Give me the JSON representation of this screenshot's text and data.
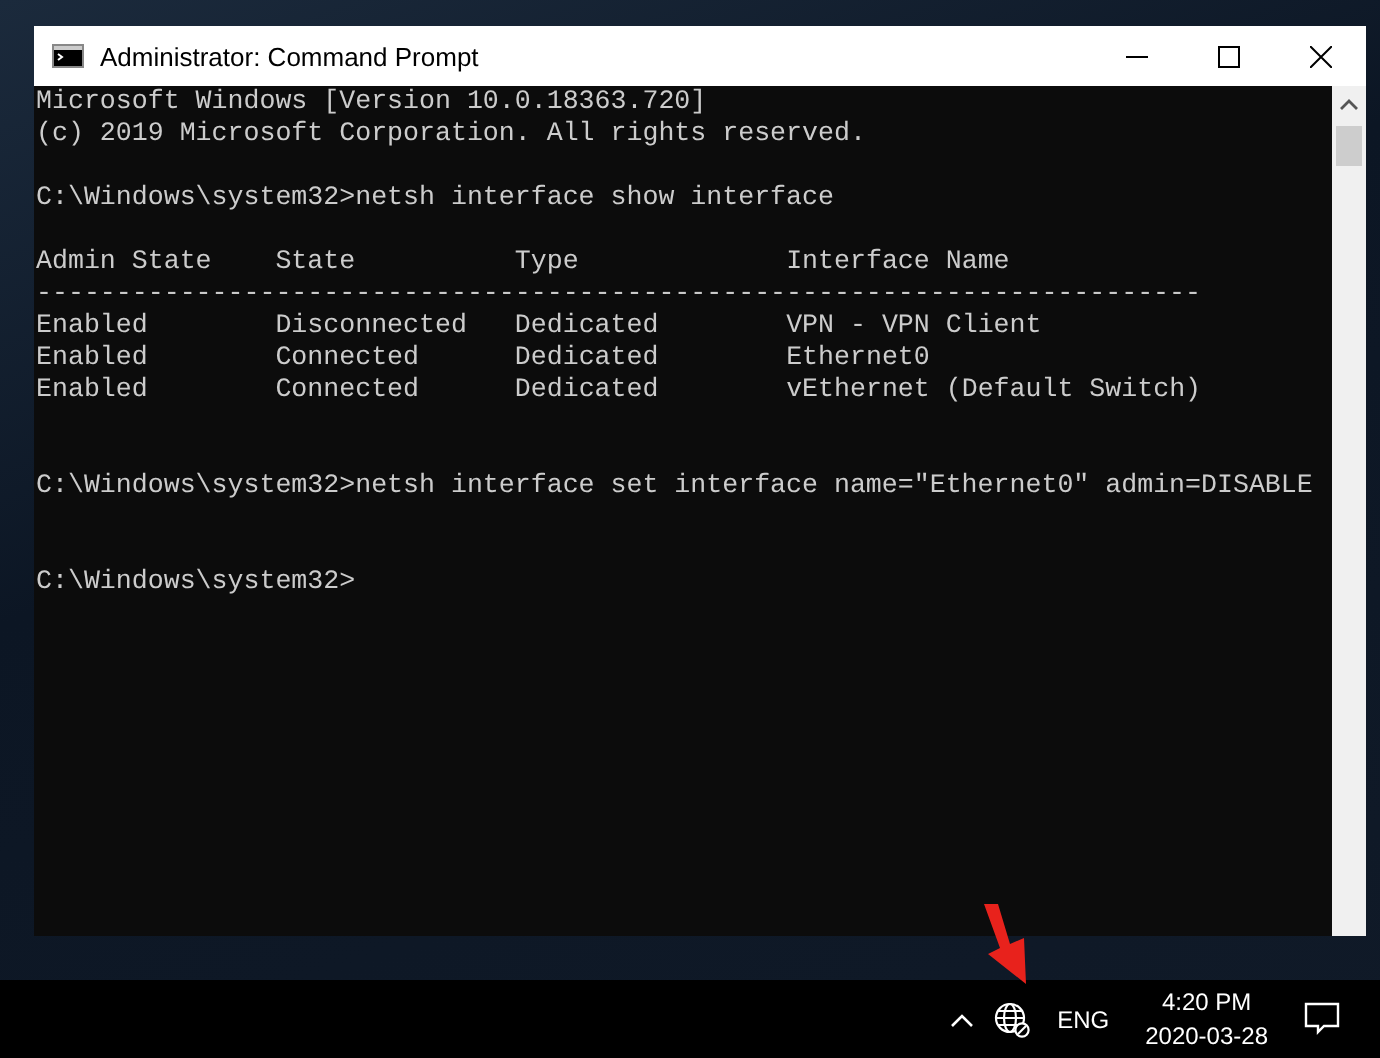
{
  "window": {
    "title": "Administrator: Command Prompt"
  },
  "console": {
    "blocks": [
      {
        "kind": "text",
        "lines": [
          "Microsoft Windows [Version 10.0.18363.720]",
          "(c) 2019 Microsoft Corporation. All rights reserved."
        ]
      },
      {
        "kind": "prompt",
        "prompt": "C:\\Windows\\system32>",
        "command": "netsh interface show interface"
      },
      {
        "kind": "table",
        "columns": [
          "Admin State",
          "State",
          "Type",
          "Interface Name"
        ],
        "rule": "-------------------------------------------------------------------------",
        "rows": [
          [
            "Enabled",
            "Disconnected",
            "Dedicated",
            "VPN - VPN Client"
          ],
          [
            "Enabled",
            "Connected",
            "Dedicated",
            "Ethernet0"
          ],
          [
            "Enabled",
            "Connected",
            "Dedicated",
            "vEthernet (Default Switch)"
          ]
        ]
      },
      {
        "kind": "prompt",
        "prompt": "C:\\Windows\\system32>",
        "command": "netsh interface set interface name=\"Ethernet0\" admin=DISABLE"
      },
      {
        "kind": "prompt",
        "prompt": "C:\\Windows\\system32>"
      }
    ]
  },
  "taskbar": {
    "language": "ENG",
    "time": "4:20 PM",
    "date": "2020-03-28"
  }
}
